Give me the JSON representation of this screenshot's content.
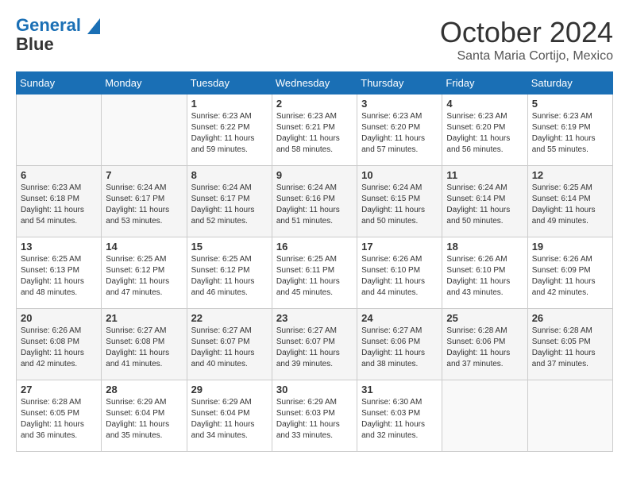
{
  "logo": {
    "line1": "General",
    "line2": "Blue"
  },
  "title": "October 2024",
  "location": "Santa Maria Cortijo, Mexico",
  "weekdays": [
    "Sunday",
    "Monday",
    "Tuesday",
    "Wednesday",
    "Thursday",
    "Friday",
    "Saturday"
  ],
  "weeks": [
    [
      {
        "day": "",
        "sunrise": "",
        "sunset": "",
        "daylight": ""
      },
      {
        "day": "",
        "sunrise": "",
        "sunset": "",
        "daylight": ""
      },
      {
        "day": "1",
        "sunrise": "Sunrise: 6:23 AM",
        "sunset": "Sunset: 6:22 PM",
        "daylight": "Daylight: 11 hours and 59 minutes."
      },
      {
        "day": "2",
        "sunrise": "Sunrise: 6:23 AM",
        "sunset": "Sunset: 6:21 PM",
        "daylight": "Daylight: 11 hours and 58 minutes."
      },
      {
        "day": "3",
        "sunrise": "Sunrise: 6:23 AM",
        "sunset": "Sunset: 6:20 PM",
        "daylight": "Daylight: 11 hours and 57 minutes."
      },
      {
        "day": "4",
        "sunrise": "Sunrise: 6:23 AM",
        "sunset": "Sunset: 6:20 PM",
        "daylight": "Daylight: 11 hours and 56 minutes."
      },
      {
        "day": "5",
        "sunrise": "Sunrise: 6:23 AM",
        "sunset": "Sunset: 6:19 PM",
        "daylight": "Daylight: 11 hours and 55 minutes."
      }
    ],
    [
      {
        "day": "6",
        "sunrise": "Sunrise: 6:23 AM",
        "sunset": "Sunset: 6:18 PM",
        "daylight": "Daylight: 11 hours and 54 minutes."
      },
      {
        "day": "7",
        "sunrise": "Sunrise: 6:24 AM",
        "sunset": "Sunset: 6:17 PM",
        "daylight": "Daylight: 11 hours and 53 minutes."
      },
      {
        "day": "8",
        "sunrise": "Sunrise: 6:24 AM",
        "sunset": "Sunset: 6:17 PM",
        "daylight": "Daylight: 11 hours and 52 minutes."
      },
      {
        "day": "9",
        "sunrise": "Sunrise: 6:24 AM",
        "sunset": "Sunset: 6:16 PM",
        "daylight": "Daylight: 11 hours and 51 minutes."
      },
      {
        "day": "10",
        "sunrise": "Sunrise: 6:24 AM",
        "sunset": "Sunset: 6:15 PM",
        "daylight": "Daylight: 11 hours and 50 minutes."
      },
      {
        "day": "11",
        "sunrise": "Sunrise: 6:24 AM",
        "sunset": "Sunset: 6:14 PM",
        "daylight": "Daylight: 11 hours and 50 minutes."
      },
      {
        "day": "12",
        "sunrise": "Sunrise: 6:25 AM",
        "sunset": "Sunset: 6:14 PM",
        "daylight": "Daylight: 11 hours and 49 minutes."
      }
    ],
    [
      {
        "day": "13",
        "sunrise": "Sunrise: 6:25 AM",
        "sunset": "Sunset: 6:13 PM",
        "daylight": "Daylight: 11 hours and 48 minutes."
      },
      {
        "day": "14",
        "sunrise": "Sunrise: 6:25 AM",
        "sunset": "Sunset: 6:12 PM",
        "daylight": "Daylight: 11 hours and 47 minutes."
      },
      {
        "day": "15",
        "sunrise": "Sunrise: 6:25 AM",
        "sunset": "Sunset: 6:12 PM",
        "daylight": "Daylight: 11 hours and 46 minutes."
      },
      {
        "day": "16",
        "sunrise": "Sunrise: 6:25 AM",
        "sunset": "Sunset: 6:11 PM",
        "daylight": "Daylight: 11 hours and 45 minutes."
      },
      {
        "day": "17",
        "sunrise": "Sunrise: 6:26 AM",
        "sunset": "Sunset: 6:10 PM",
        "daylight": "Daylight: 11 hours and 44 minutes."
      },
      {
        "day": "18",
        "sunrise": "Sunrise: 6:26 AM",
        "sunset": "Sunset: 6:10 PM",
        "daylight": "Daylight: 11 hours and 43 minutes."
      },
      {
        "day": "19",
        "sunrise": "Sunrise: 6:26 AM",
        "sunset": "Sunset: 6:09 PM",
        "daylight": "Daylight: 11 hours and 42 minutes."
      }
    ],
    [
      {
        "day": "20",
        "sunrise": "Sunrise: 6:26 AM",
        "sunset": "Sunset: 6:08 PM",
        "daylight": "Daylight: 11 hours and 42 minutes."
      },
      {
        "day": "21",
        "sunrise": "Sunrise: 6:27 AM",
        "sunset": "Sunset: 6:08 PM",
        "daylight": "Daylight: 11 hours and 41 minutes."
      },
      {
        "day": "22",
        "sunrise": "Sunrise: 6:27 AM",
        "sunset": "Sunset: 6:07 PM",
        "daylight": "Daylight: 11 hours and 40 minutes."
      },
      {
        "day": "23",
        "sunrise": "Sunrise: 6:27 AM",
        "sunset": "Sunset: 6:07 PM",
        "daylight": "Daylight: 11 hours and 39 minutes."
      },
      {
        "day": "24",
        "sunrise": "Sunrise: 6:27 AM",
        "sunset": "Sunset: 6:06 PM",
        "daylight": "Daylight: 11 hours and 38 minutes."
      },
      {
        "day": "25",
        "sunrise": "Sunrise: 6:28 AM",
        "sunset": "Sunset: 6:06 PM",
        "daylight": "Daylight: 11 hours and 37 minutes."
      },
      {
        "day": "26",
        "sunrise": "Sunrise: 6:28 AM",
        "sunset": "Sunset: 6:05 PM",
        "daylight": "Daylight: 11 hours and 37 minutes."
      }
    ],
    [
      {
        "day": "27",
        "sunrise": "Sunrise: 6:28 AM",
        "sunset": "Sunset: 6:05 PM",
        "daylight": "Daylight: 11 hours and 36 minutes."
      },
      {
        "day": "28",
        "sunrise": "Sunrise: 6:29 AM",
        "sunset": "Sunset: 6:04 PM",
        "daylight": "Daylight: 11 hours and 35 minutes."
      },
      {
        "day": "29",
        "sunrise": "Sunrise: 6:29 AM",
        "sunset": "Sunset: 6:04 PM",
        "daylight": "Daylight: 11 hours and 34 minutes."
      },
      {
        "day": "30",
        "sunrise": "Sunrise: 6:29 AM",
        "sunset": "Sunset: 6:03 PM",
        "daylight": "Daylight: 11 hours and 33 minutes."
      },
      {
        "day": "31",
        "sunrise": "Sunrise: 6:30 AM",
        "sunset": "Sunset: 6:03 PM",
        "daylight": "Daylight: 11 hours and 32 minutes."
      },
      {
        "day": "",
        "sunrise": "",
        "sunset": "",
        "daylight": ""
      },
      {
        "day": "",
        "sunrise": "",
        "sunset": "",
        "daylight": ""
      }
    ]
  ]
}
